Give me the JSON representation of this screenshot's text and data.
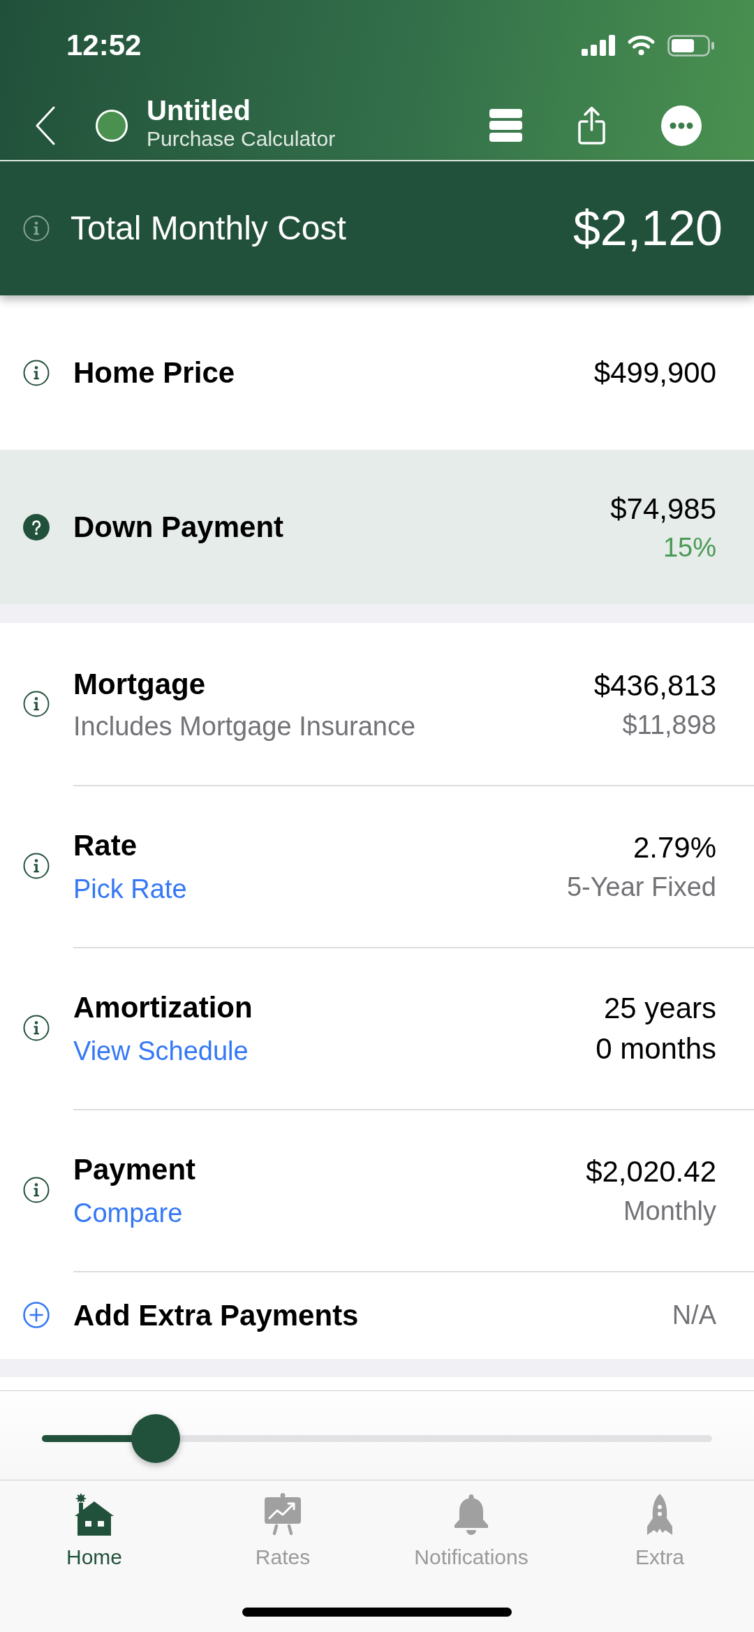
{
  "status_bar": {
    "time": "12:52"
  },
  "nav_bar": {
    "title": "Untitled",
    "subtitle": "Purchase Calculator"
  },
  "summary": {
    "label": "Total Monthly Cost",
    "value": "$2,120"
  },
  "sections": [
    {
      "rows": [
        {
          "kind": "info",
          "label": "Home Price",
          "values": [
            {
              "text": "$499,900",
              "kind": "main"
            }
          ],
          "selected": false
        },
        {
          "kind": "help",
          "label": "Down Payment",
          "values": [
            {
              "text": "$74,985",
              "kind": "main"
            },
            {
              "text": "15%",
              "kind": "accent"
            }
          ],
          "selected": true
        }
      ]
    },
    {
      "rows": [
        {
          "kind": "info",
          "label": "Mortgage",
          "detail": "Includes Mortgage Insurance",
          "values": [
            {
              "text": "$436,813",
              "kind": "main"
            },
            {
              "text": "$11,898",
              "kind": "muted"
            }
          ],
          "selected": false
        },
        {
          "kind": "info",
          "label": "Rate",
          "link": "Pick Rate",
          "values": [
            {
              "text": "2.79%",
              "kind": "main"
            },
            {
              "text": "5-Year Fixed",
              "kind": "muted"
            }
          ],
          "selected": false
        },
        {
          "kind": "info",
          "label": "Amortization",
          "link": "View Schedule",
          "values": [
            {
              "text": "25 years",
              "kind": "main"
            },
            {
              "text": "0 months",
              "kind": "main"
            }
          ],
          "selected": false
        },
        {
          "kind": "info",
          "label": "Payment",
          "link": "Compare",
          "values": [
            {
              "text": "$2,020.42",
              "kind": "main"
            },
            {
              "text": "Monthly",
              "kind": "muted"
            }
          ],
          "selected": false
        },
        {
          "kind": "add",
          "label": "Add Extra Payments",
          "values": [
            {
              "text": "N/A",
              "kind": "muted"
            }
          ],
          "selected": false
        }
      ]
    }
  ],
  "slider": {
    "level": 0.17
  },
  "tab_bar": {
    "tabs": [
      {
        "label": "Home",
        "selected": true
      },
      {
        "label": "Rates",
        "selected": false
      },
      {
        "label": "Notifications",
        "selected": false
      },
      {
        "label": "Extra",
        "selected": false
      }
    ]
  }
}
